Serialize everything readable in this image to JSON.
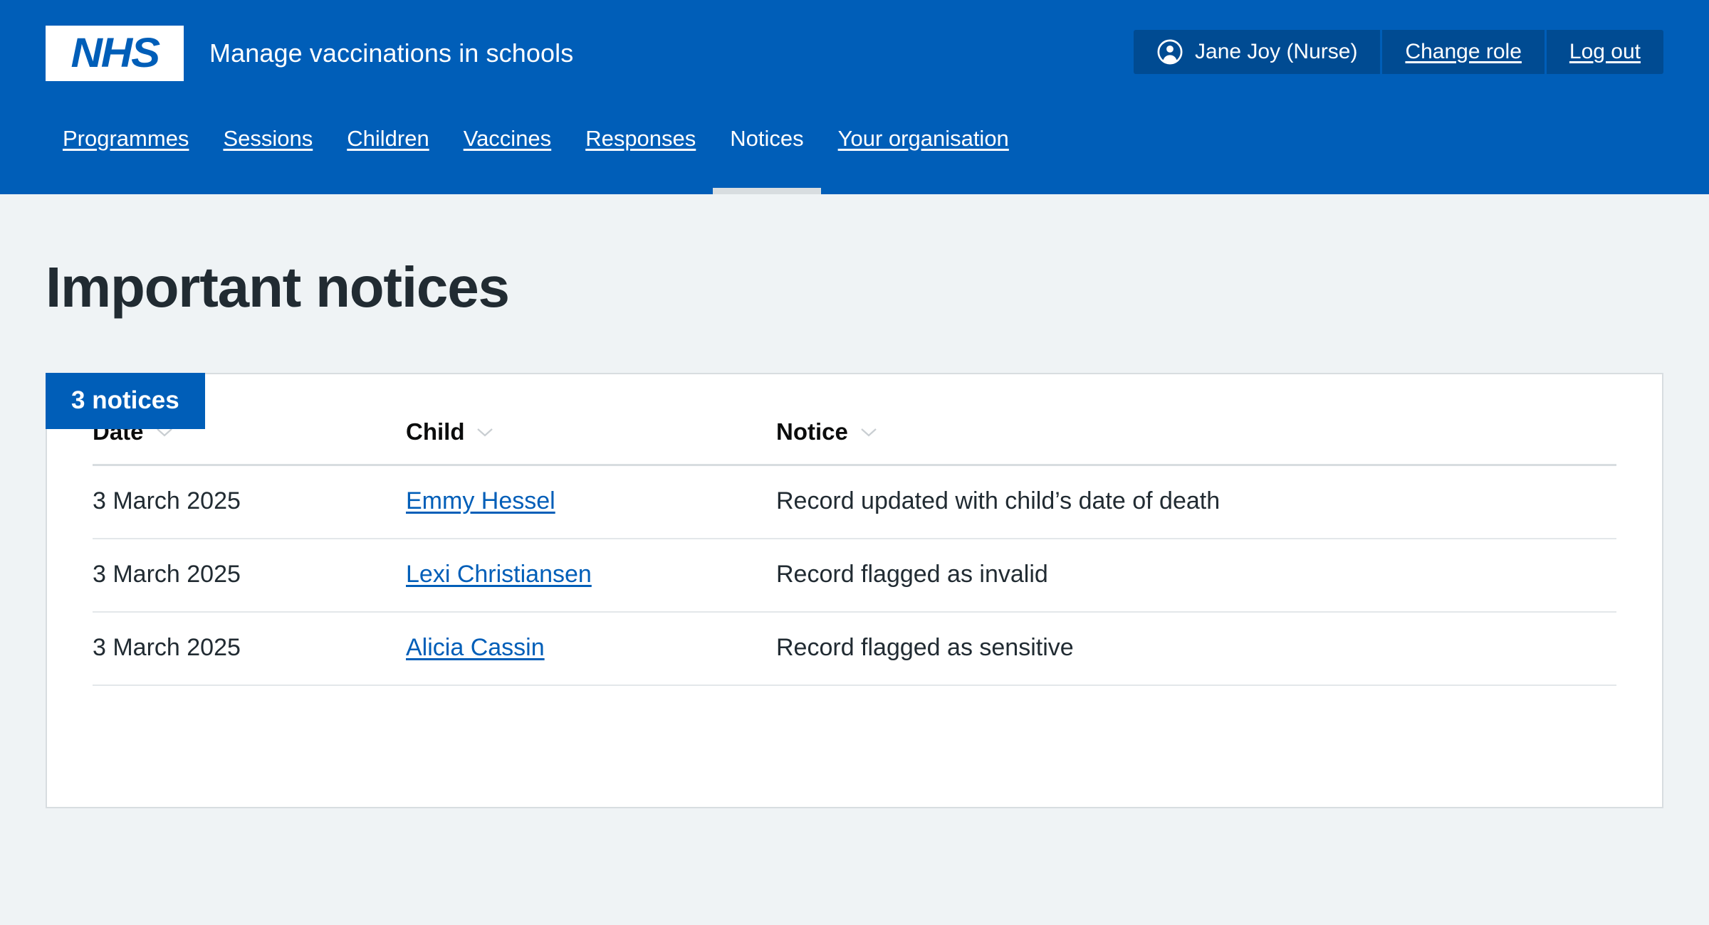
{
  "header": {
    "logo_text": "NHS",
    "logo_name": "nhs-logo",
    "service_name": "Manage vaccinations in schools",
    "account": {
      "user_icon": "user-circle-icon",
      "user_label": "Jane Joy (Nurse)",
      "change_role_label": "Change role",
      "log_out_label": "Log out"
    },
    "nav": [
      {
        "label": "Programmes",
        "active": false
      },
      {
        "label": "Sessions",
        "active": false
      },
      {
        "label": "Children",
        "active": false
      },
      {
        "label": "Vaccines",
        "active": false
      },
      {
        "label": "Responses",
        "active": false
      },
      {
        "label": "Notices",
        "active": true
      },
      {
        "label": "Your organisation",
        "active": false
      }
    ]
  },
  "main": {
    "page_title": "Important notices",
    "card_tab_label": "3 notices",
    "table": {
      "columns": [
        {
          "label": "Date",
          "sort_icon": "chevron-down-icon"
        },
        {
          "label": "Child",
          "sort_icon": "chevron-down-icon"
        },
        {
          "label": "Notice",
          "sort_icon": "chevron-down-icon"
        }
      ],
      "rows": [
        {
          "date": "3 March 2025",
          "child": "Emmy Hessel",
          "notice": "Record updated with child’s date of death"
        },
        {
          "date": "3 March 2025",
          "child": "Lexi Christiansen",
          "notice": "Record flagged as invalid"
        },
        {
          "date": "3 March 2025",
          "child": "Alicia Cassin",
          "notice": "Record flagged as sensitive"
        }
      ]
    }
  },
  "colors": {
    "nhs_blue": "#005eb8",
    "nhs_dark_blue": "#004b92",
    "page_background": "#eff3f5",
    "text_dark": "#212b32",
    "border_grey": "#d8dde0"
  }
}
